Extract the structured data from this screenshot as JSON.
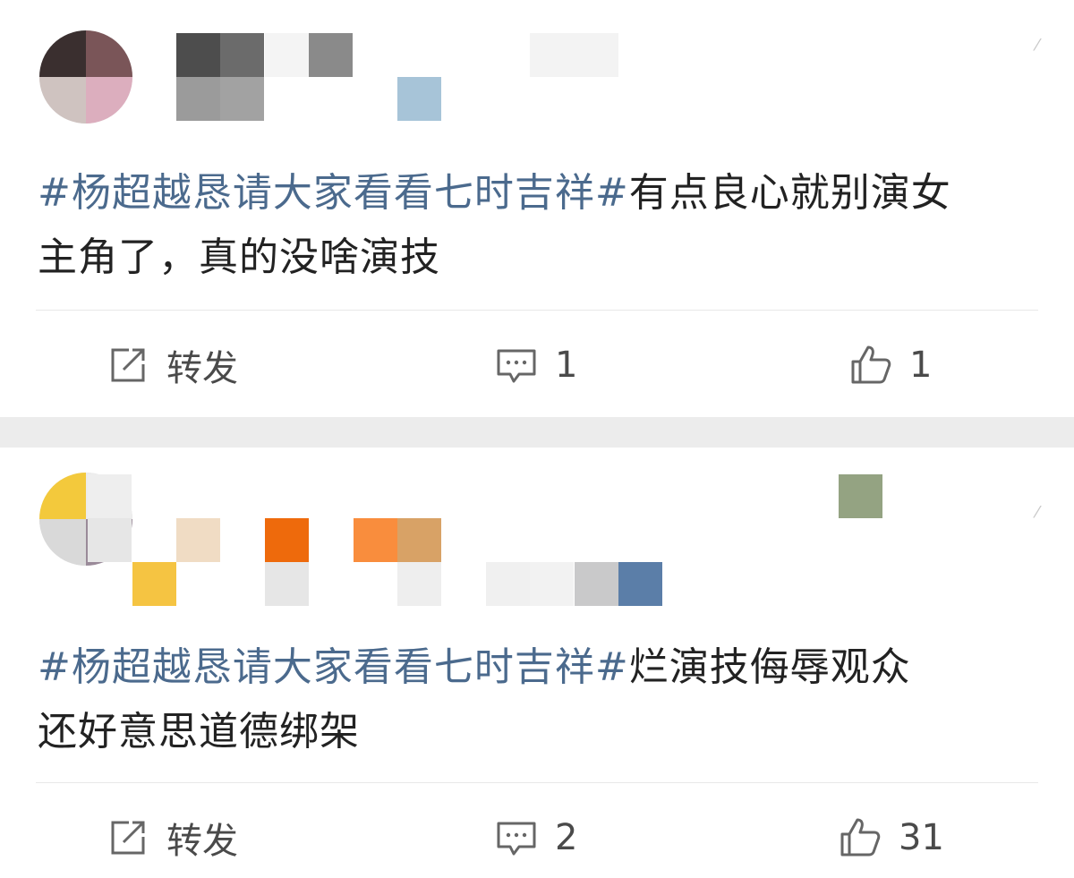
{
  "posts": [
    {
      "hashtag": "#杨超越恳请大家看看七时吉祥#",
      "text_line1_rest": "有点良心就别演女",
      "text_line2": "主角了，真的没啥演技",
      "actions": {
        "repost_label": "转发",
        "comment_count": "1",
        "like_count": "1"
      }
    },
    {
      "hashtag": "#杨超越恳请大家看看七时吉祥#",
      "text_line1_rest": "烂演技侮辱观众",
      "text_line2": "还好意思道德绑架",
      "actions": {
        "repost_label": "转发",
        "comment_count": "2",
        "like_count": "31"
      }
    }
  ],
  "icons": {
    "repost": "repost-icon",
    "comment": "comment-icon",
    "like": "thumbs-up-icon",
    "more": "more-icon"
  },
  "colors": {
    "hashtag": "#4b6a8d",
    "text": "#222222",
    "separator": "#ececec",
    "icon": "#666666"
  }
}
